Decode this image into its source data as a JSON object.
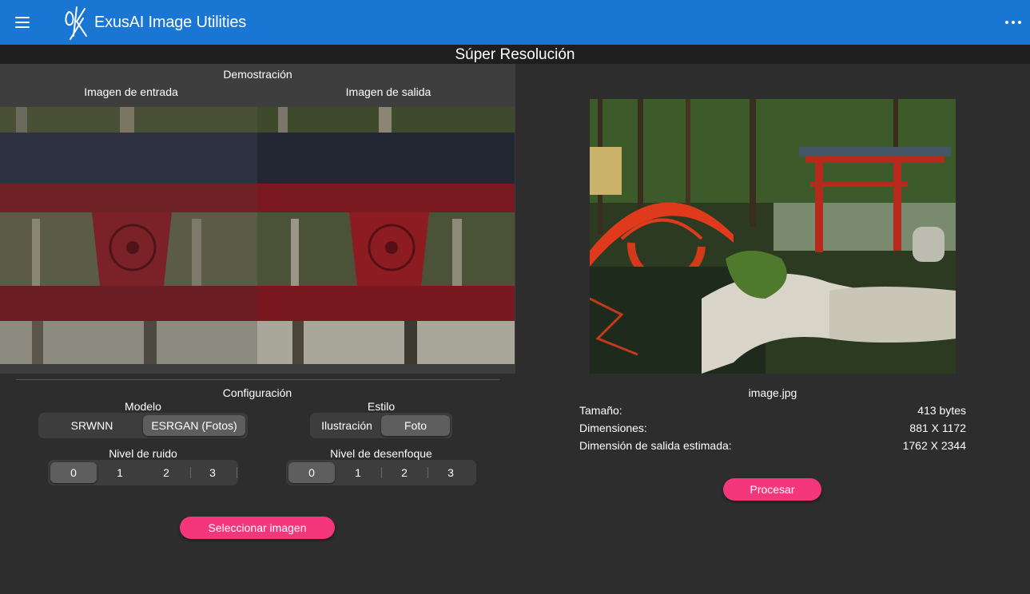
{
  "app": {
    "title": "ExusAI Image Utilities"
  },
  "page": {
    "title": "Súper Resolución"
  },
  "demo": {
    "title": "Demostración",
    "input_label": "Imagen de entrada",
    "output_label": "Imagen de salida"
  },
  "config": {
    "title": "Configuración",
    "model": {
      "label": "Modelo",
      "options": [
        "SRWNN",
        "ESRGAN (Fotos)"
      ],
      "selected": "ESRGAN (Fotos)"
    },
    "style": {
      "label": "Estilo",
      "options": [
        "Ilustración",
        "Foto"
      ],
      "selected": "Foto"
    },
    "noise": {
      "label": "Nivel de ruido",
      "options": [
        "0",
        "1",
        "2",
        "3"
      ],
      "selected": "0"
    },
    "blur": {
      "label": "Nivel de desenfoque",
      "options": [
        "0",
        "1",
        "2",
        "3"
      ],
      "selected": "0"
    }
  },
  "select_button": "Seleccionar imagen",
  "file": {
    "name": "image.jpg",
    "size_label": "Tamaño:",
    "size_value": "413 bytes",
    "dims_label": "Dimensiones:",
    "dims_value": "881 X 1172",
    "out_label": "Dimensión de salida estimada:",
    "out_value": "1762 X 2344"
  },
  "process_button": "Procesar",
  "colors": {
    "appbar": "#1976d2",
    "accent": "#f4377a",
    "background": "#2d2d2d"
  }
}
